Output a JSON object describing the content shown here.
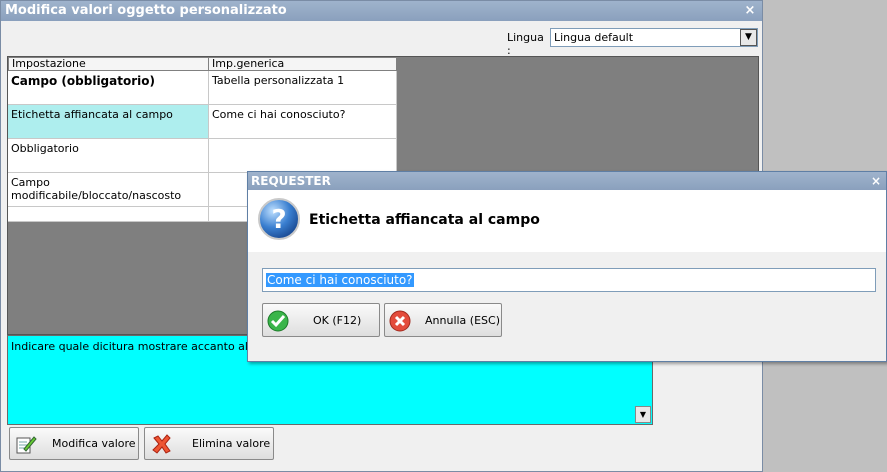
{
  "main": {
    "title": "Modifica valori oggetto personalizzato",
    "close_glyph": "×",
    "lingua_label": "Lingua :",
    "lingua_value": "Lingua default",
    "grid": {
      "headers": [
        "Impostazione",
        "Imp.generica"
      ],
      "rows": [
        {
          "label": "Campo (obbligatorio)",
          "value": "Tabella personalizzata 1"
        },
        {
          "label": "Etichetta affiancata al campo",
          "value": "Come ci hai conosciuto?"
        },
        {
          "label": "Obbligatorio",
          "value": ""
        },
        {
          "label": "Campo modificabile/bloccato/nascosto",
          "value": ""
        }
      ]
    },
    "description": "Indicare quale dicitura mostrare accanto al campo",
    "buttons": {
      "modifica": "Modifica valore",
      "elimina": "Elimina valore"
    }
  },
  "requester": {
    "title": "REQUESTER",
    "close_glyph": "×",
    "question": "Etichetta affiancata al campo",
    "input_value": "Come ci hai conosciuto?",
    "ok_label": "OK (F12)",
    "cancel_label": "Annulla (ESC)"
  },
  "icons": {
    "question": "question-icon",
    "edit": "edit-icon",
    "delete": "delete-icon",
    "ok": "checkmark-icon",
    "cancel": "cancel-icon"
  },
  "colors": {
    "titlebar": "#9fb3cc",
    "description_bg": "#00ffff",
    "selected_cell": "#aeeeee",
    "selection": "#3399ff"
  }
}
